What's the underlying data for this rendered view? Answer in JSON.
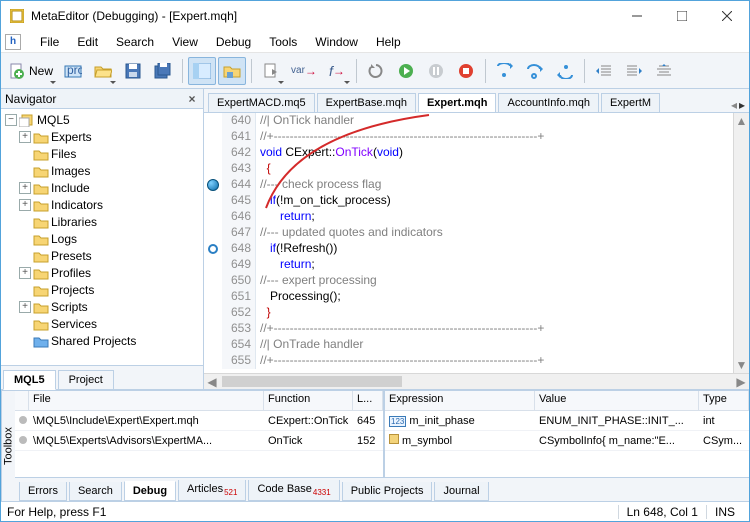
{
  "title": "MetaEditor (Debugging) - [Expert.mqh]",
  "menu": [
    "File",
    "Edit",
    "Search",
    "View",
    "Debug",
    "Tools",
    "Window",
    "Help"
  ],
  "toolbar": {
    "new_label": "New"
  },
  "navigator": {
    "title": "Navigator",
    "root": "MQL5",
    "items": [
      {
        "label": "Experts",
        "toggle": "+"
      },
      {
        "label": "Files",
        "toggle": ""
      },
      {
        "label": "Images",
        "toggle": ""
      },
      {
        "label": "Include",
        "toggle": "+"
      },
      {
        "label": "Indicators",
        "toggle": "+"
      },
      {
        "label": "Libraries",
        "toggle": ""
      },
      {
        "label": "Logs",
        "toggle": ""
      },
      {
        "label": "Presets",
        "toggle": ""
      },
      {
        "label": "Profiles",
        "toggle": "+"
      },
      {
        "label": "Projects",
        "toggle": ""
      },
      {
        "label": "Scripts",
        "toggle": "+"
      },
      {
        "label": "Services",
        "toggle": ""
      },
      {
        "label": "Shared Projects",
        "toggle": "",
        "icon": "shared"
      }
    ],
    "tabs": [
      "MQL5",
      "Project"
    ]
  },
  "editor": {
    "tabs": [
      "ExpertMACD.mq5",
      "ExpertBase.mqh",
      "Expert.mqh",
      "AccountInfo.mqh",
      "ExpertM"
    ],
    "active_tab": 2,
    "lines": [
      {
        "n": 640,
        "bp": "",
        "html": "<span class='c-comment'>//| OnTick handler</span>"
      },
      {
        "n": 641,
        "bp": "",
        "html": "<span class='c-comment'>//+------------------------------------------------------------------+</span>"
      },
      {
        "n": 642,
        "bp": "",
        "html": "<span class='c-type'>void</span> CExpert::<span class='c-ident'>OnTick</span>(<span class='c-type'>void</span>)"
      },
      {
        "n": 643,
        "bp": "",
        "html": "  <span class='c-brace'>{</span>"
      },
      {
        "n": 644,
        "bp": "circle",
        "html": "<span class='c-comment'>//--- check process flag</span>"
      },
      {
        "n": 645,
        "bp": "",
        "html": "   <span class='c-keyword'>if</span>(!m_on_tick_process)"
      },
      {
        "n": 646,
        "bp": "",
        "html": "      <span class='c-keyword'>return</span>;"
      },
      {
        "n": 647,
        "bp": "",
        "html": "<span class='c-comment'>//--- updated quotes and indicators</span>"
      },
      {
        "n": 648,
        "bp": "ring",
        "html": "   <span class='c-keyword'>if</span>(!Refresh())"
      },
      {
        "n": 649,
        "bp": "",
        "html": "      <span class='c-keyword'>return</span>;"
      },
      {
        "n": 650,
        "bp": "",
        "html": "<span class='c-comment'>//--- expert processing</span>"
      },
      {
        "n": 651,
        "bp": "",
        "html": "   Processing();"
      },
      {
        "n": 652,
        "bp": "",
        "html": "  <span class='c-brace'>}</span>"
      },
      {
        "n": 653,
        "bp": "",
        "html": "<span class='c-comment'>//+------------------------------------------------------------------+</span>"
      },
      {
        "n": 654,
        "bp": "",
        "html": "<span class='c-comment'>//| OnTrade handler</span>"
      },
      {
        "n": 655,
        "bp": "",
        "html": "<span class='c-comment'>//+------------------------------------------------------------------+</span>"
      }
    ]
  },
  "callstack": {
    "headers": [
      "File",
      "Function",
      "L..."
    ],
    "rows": [
      {
        "file": "\\MQL5\\Include\\Expert\\Expert.mqh",
        "func": "CExpert::OnTick",
        "line": "645"
      },
      {
        "file": "\\MQL5\\Experts\\Advisors\\ExpertMA...",
        "func": "OnTick",
        "line": "152"
      }
    ]
  },
  "watch": {
    "headers": [
      "Expression",
      "Value",
      "Type"
    ],
    "rows": [
      {
        "expr": "m_init_phase",
        "icon": "123",
        "val": "ENUM_INIT_PHASE::INIT_...",
        "type": "int"
      },
      {
        "expr": "m_symbol",
        "icon": "obj",
        "val": "CSymbolInfo{ m_name:\"E...",
        "type": "CSym..."
      }
    ]
  },
  "bottom_tabs": [
    {
      "label": "Errors",
      "badge": ""
    },
    {
      "label": "Search",
      "badge": ""
    },
    {
      "label": "Debug",
      "badge": "",
      "active": true
    },
    {
      "label": "Articles",
      "badge": "521"
    },
    {
      "label": "Code Base",
      "badge": "4331"
    },
    {
      "label": "Public Projects",
      "badge": ""
    },
    {
      "label": "Journal",
      "badge": ""
    }
  ],
  "toolbox_label": "Toolbox",
  "status": {
    "help": "For Help, press F1",
    "pos": "Ln 648, Col 1",
    "mode": "INS"
  }
}
